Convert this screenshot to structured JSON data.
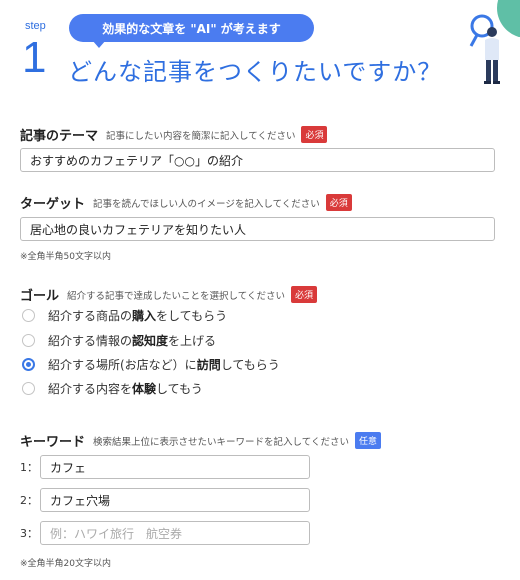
{
  "header": {
    "step_label": "step",
    "step_number": "1",
    "bubble": "効果的な文章を \"AI\" が考えます",
    "title": "どんな記事をつくりたいですか？"
  },
  "theme": {
    "title": "記事のテーマ",
    "desc": "記事にしたい内容を簡潔に記入してください",
    "badge": "必須",
    "value": "おすすめのカフェテリア「○○」の紹介"
  },
  "target": {
    "title": "ターゲット",
    "desc": "記事を読んでほしい人のイメージを記入してください",
    "badge": "必須",
    "value": "居心地の良いカフェテリアを知りたい人",
    "note": "※全角半角50文字以内"
  },
  "goal": {
    "title": "ゴール",
    "desc": "紹介する記事で達成したいことを選択してください",
    "badge": "必須",
    "options": [
      {
        "pre": "紹介する商品の",
        "bold": "購入",
        "post": "をしてもらう",
        "checked": false
      },
      {
        "pre": "紹介する情報の",
        "bold": "認知度",
        "post": "を上げる",
        "checked": false
      },
      {
        "pre": "紹介する場所(お店など）に",
        "bold": "訪問",
        "post": "してもらう",
        "checked": true
      },
      {
        "pre": "紹介する内容を",
        "bold": "体験",
        "post": "してもう",
        "checked": false
      }
    ]
  },
  "keyword": {
    "title": "キーワード",
    "desc": "検索結果上位に表示させたいキーワードを記入してください",
    "badge": "任意",
    "rows": [
      {
        "index": "1：",
        "value": "カフェ",
        "placeholder": ""
      },
      {
        "index": "2：",
        "value": "カフェ穴場",
        "placeholder": ""
      },
      {
        "index": "3：",
        "value": "",
        "placeholder": "例：ハワイ旅行　航空券"
      }
    ],
    "note": "※全角半角20文字以内"
  },
  "colors": {
    "accent": "#2f6fe0",
    "required": "#d93a3a",
    "optional": "#4b7cf0"
  }
}
